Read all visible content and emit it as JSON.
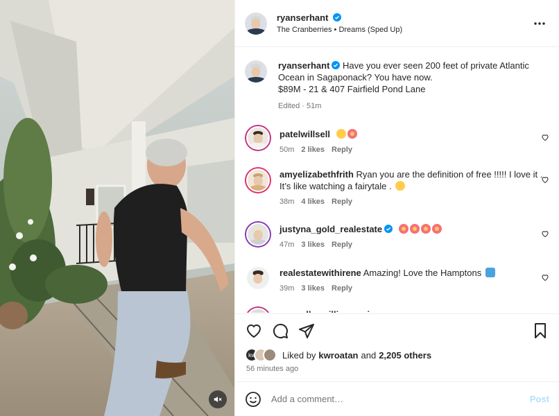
{
  "header": {
    "username": "ryanserhant",
    "song": "The Cranberries • Dreams (Sped Up)",
    "more_icon": "more-horizontal-icon"
  },
  "caption": {
    "username": "ryanserhant",
    "line1": "Have you ever seen 200 feet of private Atlantic Ocean in Sagaponack? You have now.",
    "line2": "$89M - 21 & 407 Fairfield Pond Lane",
    "meta": "Edited · 51m"
  },
  "comments": [
    {
      "username": "patelwillsell",
      "text": "",
      "emoji": [
        "face-with-open-mouth",
        "smiling-face-with-heart-eyes"
      ],
      "time": "50m",
      "likes": "2 likes",
      "reply": "Reply",
      "ring": "#c13584"
    },
    {
      "username": "amyelizabethfrith",
      "text": "Ryan you are the definition of free !!!!! I love it . It’s like watching a fairytale .",
      "emoji": [
        "hugging-face"
      ],
      "time": "38m",
      "likes": "4 likes",
      "reply": "Reply",
      "ring": "#e1306c"
    },
    {
      "username": "justyna_gold_realestate",
      "text": "",
      "emoji": [
        "smiling-face-with-heart-eyes",
        "smiling-face-with-heart-eyes",
        "smiling-face-with-heart-eyes",
        "smiling-face-with-heart-eyes"
      ],
      "time": "47m",
      "likes": "3 likes",
      "reply": "Reply",
      "ring": "#833ab4"
    },
    {
      "username": "realestatewithirene",
      "text": "Amazing! Love the Hamptons",
      "emoji": [
        "water-wave"
      ],
      "time": "39m",
      "likes": "3 likes",
      "reply": "Reply",
      "ring": ""
    }
  ],
  "partial_comment": {
    "username": "marcelluswilliamsusic"
  },
  "actions": {
    "like_icon": "heart-icon",
    "comment_icon": "comment-icon",
    "share_icon": "share-icon",
    "save_icon": "bookmark-icon"
  },
  "likes": {
    "prefix": "Liked by",
    "user": "kwroatan",
    "joiner": "and",
    "count": "2,205 others",
    "badge": "kw"
  },
  "posted": "56 minutes ago",
  "add_comment": {
    "placeholder": "Add a comment…",
    "post_label": "Post",
    "emoji_icon": "smiley-icon"
  },
  "colors": {
    "verified": "#0095f6",
    "post_disabled": "#b2dffc",
    "secondary_text": "#737373"
  },
  "media": {
    "mute_icon": "speaker-muted-icon"
  }
}
